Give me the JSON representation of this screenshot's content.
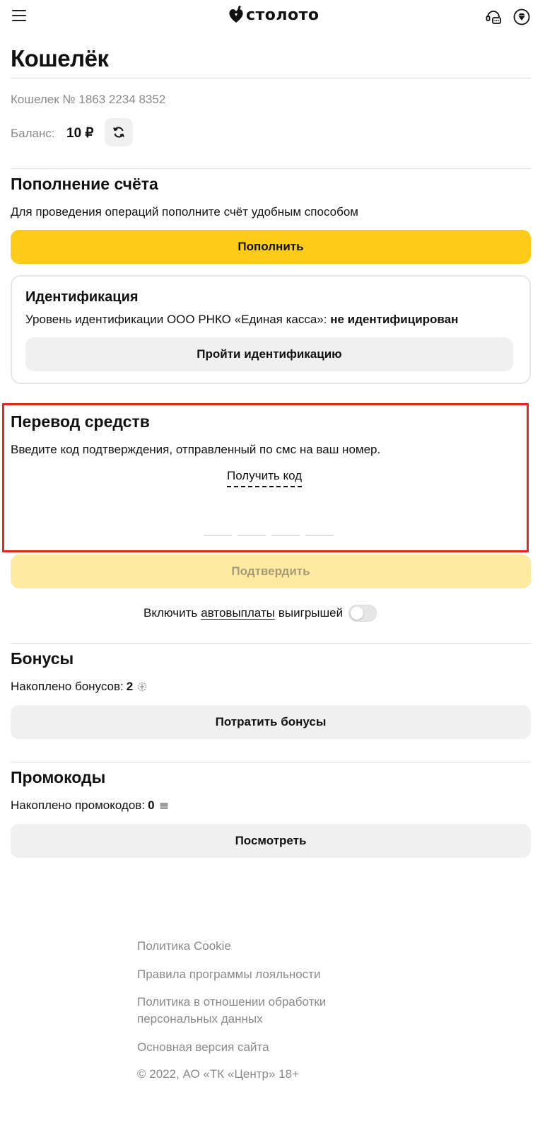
{
  "header": {
    "logo_text": "столото",
    "icons": {
      "menu": "menu-icon",
      "support": "support-chat-icon",
      "premium": "diamond-icon"
    }
  },
  "page_title": "Кошелёк",
  "wallet": {
    "number_text": "Кошелек № 1863 2234 8352",
    "balance_label": "Баланс:",
    "balance_value": "10 ₽"
  },
  "topup": {
    "title": "Пополнение счёта",
    "description": "Для проведения операций пополните счёт удобным способом",
    "button_label": "Пополнить"
  },
  "identification": {
    "title": "Идентификация",
    "level_text": "Уровень идентификации ООО РНКО «Единая касса»:",
    "status": "не идентифицирован",
    "button_label": "Пройти идентификацию"
  },
  "transfer": {
    "title": "Перевод средств",
    "description": "Введите код подтверждения, отправленный по смс на ваш номер.",
    "get_code_label": "Получить код",
    "code_cells": [
      "",
      "",
      "",
      ""
    ],
    "confirm_label": "Подтвердить"
  },
  "autopay": {
    "prefix": "Включить",
    "link": "автовыплаты",
    "suffix": "выигрышей",
    "enabled": false
  },
  "bonuses": {
    "title": "Бонусы",
    "accumulated_label": "Накоплено бонусов:",
    "accumulated_value": "2",
    "button_label": "Потратить бонусы"
  },
  "promocodes": {
    "title": "Промокоды",
    "accumulated_label": "Накоплено промокодов:",
    "accumulated_value": "0",
    "button_label": "Посмотреть"
  },
  "footer": {
    "links": [
      "Политика Cookie",
      "Правила программы лояльности",
      "Политика в отношении обработки персональных данных",
      "Основная версия сайта"
    ],
    "copyright": "© 2022, АО «ТК «Центр» 18+"
  },
  "colors": {
    "accent_yellow": "#fecc18",
    "disabled_yellow": "#feeaa1",
    "highlight_red": "#e8281e",
    "muted_text": "#8a8a8a"
  }
}
